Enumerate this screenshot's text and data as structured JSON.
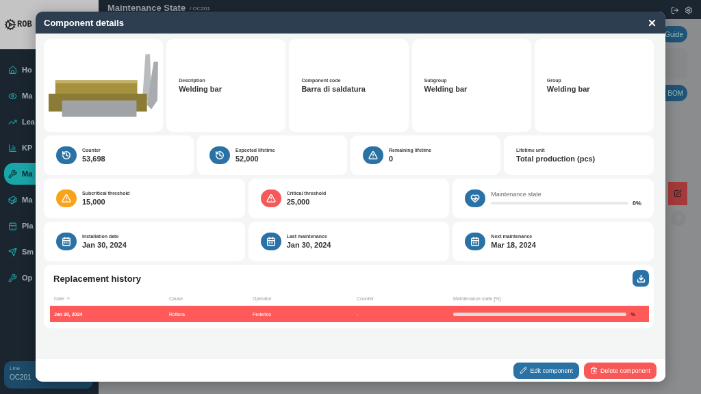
{
  "background": {
    "logo_text": "ROB",
    "header_title": "Maintenance State",
    "header_subtitle": "/ OC201",
    "guide_button": "Guide",
    "bom_button": "BOM",
    "nav": [
      {
        "label": "Ho",
        "selected": false
      },
      {
        "label": "Ma",
        "selected": false
      },
      {
        "label": "Lea",
        "selected": false
      },
      {
        "label": "KP",
        "selected": false
      },
      {
        "label": "Ma",
        "selected": true
      },
      {
        "label": "Ma",
        "selected": false
      },
      {
        "label": "Pla",
        "selected": false
      },
      {
        "label": "Sm",
        "selected": false
      },
      {
        "label": "Op",
        "selected": false
      }
    ],
    "line_card": {
      "label": "Line",
      "value": "OC201"
    }
  },
  "dialog": {
    "title": "Component details",
    "info_fields": [
      {
        "label": "Description",
        "value": "Welding bar"
      },
      {
        "label": "Component code",
        "value": "Barra di saldatura"
      },
      {
        "label": "Subgroup",
        "value": "Welding bar"
      },
      {
        "label": "Group",
        "value": "Welding bar"
      }
    ],
    "stat_rows": [
      [
        {
          "kind": "history",
          "color": "#2a72a6",
          "label": "Counter",
          "value": "53,698"
        },
        {
          "kind": "history",
          "color": "#2a72a6",
          "label": "Expected lifetime",
          "value": "52,000"
        },
        {
          "kind": "warning",
          "color": "#2a72a6",
          "label": "Remaining lifetime",
          "value": "0"
        },
        {
          "kind": "plain",
          "label": "Lifetime unit",
          "value": "Total production (pcs)"
        }
      ],
      [
        {
          "kind": "warning",
          "color": "#f9a31b",
          "label": "Subcritical threshold",
          "value": "15,000"
        },
        {
          "kind": "warning",
          "color": "#f55a5a",
          "label": "Critical threshold",
          "value": "25,000"
        },
        {
          "kind": "meter",
          "color": "#2a72a6",
          "label": "Maintenance state",
          "reading": "0%"
        }
      ],
      [
        {
          "kind": "calendar",
          "color": "#2a72a6",
          "label": "Installation date",
          "value": "Jan 30, 2024"
        },
        {
          "kind": "calendar",
          "color": "#2a72a6",
          "label": "Last maintenance",
          "value": "Jan 30, 2024"
        },
        {
          "kind": "calendar",
          "color": "#2a72a6",
          "label": "Next maintenance",
          "value": "Mar 18, 2024"
        }
      ]
    ],
    "history": {
      "title": "Replacement history",
      "columns": [
        {
          "label": "Date",
          "sorted": true
        },
        {
          "label": "Cause",
          "sorted": false
        },
        {
          "label": "Operator",
          "sorted": false
        },
        {
          "label": "Counter",
          "sorted": false
        },
        {
          "label": "Maintenance state [%]",
          "sorted": false
        }
      ],
      "rows": [
        {
          "highlighted": true,
          "date": "Jan 30, 2024",
          "cause": "Rottura",
          "operator": "Federico",
          "counter": "-",
          "reading": "-%"
        }
      ]
    },
    "buttons": [
      {
        "kind": "edit",
        "label": "Edit component"
      },
      {
        "kind": "delete",
        "label": "Delete component"
      }
    ]
  }
}
